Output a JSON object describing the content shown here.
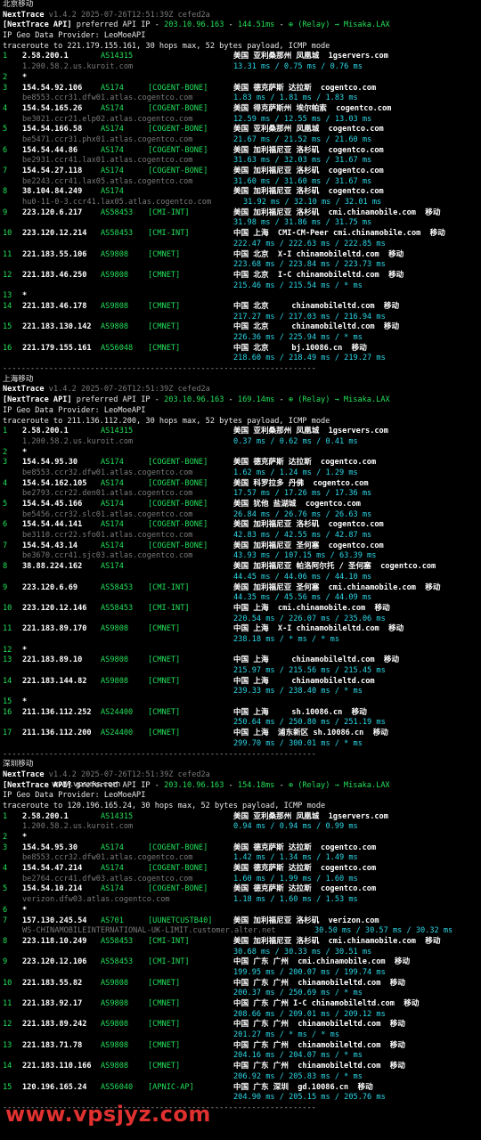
{
  "theme": {
    "background": "#000000",
    "hop_green": "#22e05a",
    "latency_cyan": "#2ad8e8",
    "dim": "#7a7a7a",
    "watermark_red": "#e03030"
  },
  "sections": [
    {
      "title": "北京移动",
      "banner": {
        "name": "NextTrace",
        "version": "v1.4.2 2025-07-26T12:51:39Z cefed2a"
      },
      "api_line": {
        "prefix": "[NextTrace API]",
        "label": "preferred API IP - ",
        "ip": "203.10.96.163",
        "sep1": " - ",
        "latency": "144.51ms",
        "sep2": " - ",
        "relay": "⊕ (Relay) → Misaka.LAX"
      },
      "geo_provider": "IP Geo Data Provider: LeoMoeAPI",
      "traceroute": "traceroute to 221.179.155.161, 30 hops max, 52 bytes payload, ICMP mode",
      "hops": [
        {
          "hop": "1",
          "ip": "2.58.200.1",
          "asn": "AS14315",
          "tag": "",
          "geo": "美国 亚利桑那州 凤凰城  1gservers.com",
          "sub": "1.200.58.2.us.kuroit.com",
          "rtt": "13.31 ms / 0.75 ms / 0.76 ms"
        },
        {
          "hop": "2",
          "ip": "*"
        },
        {
          "hop": "3",
          "ip": "154.54.92.106",
          "asn": "AS174",
          "tag": "[COGENT-BONE]",
          "geo": "美国 德克萨斯 达拉斯  cogentco.com",
          "sub": "be8553.ccr31.dfw01.atlas.cogentco.com",
          "rtt": "1.83 ms / 1.81 ms / 1.83 ms"
        },
        {
          "hop": "4",
          "ip": "154.54.165.26",
          "asn": "AS174",
          "tag": "[COGENT-BONE]",
          "geo": "美国 得克萨斯州 埃尔帕索  cogentco.com",
          "sub": "be3021.ccr21.elp02.atlas.cogentco.com",
          "rtt": "12.59 ms / 12.55 ms / 13.03 ms"
        },
        {
          "hop": "5",
          "ip": "154.54.166.58",
          "asn": "AS174",
          "tag": "[COGENT-BONE]",
          "geo": "美国 亚利桑那州 凤凰城  cogentco.com",
          "sub": "be5471.ccr31.phx01.atlas.cogentco.com",
          "rtt": "21.67 ms / 21.52 ms / 21.60 ms"
        },
        {
          "hop": "6",
          "ip": "154.54.44.86",
          "asn": "AS174",
          "tag": "[COGENT-BONE]",
          "geo": "美国 加利福尼亚 洛杉矶  cogentco.com",
          "sub": "be2931.ccr41.lax01.atlas.cogentco.com",
          "rtt": "31.63 ms / 32.03 ms / 31.67 ms"
        },
        {
          "hop": "7",
          "ip": "154.54.27.118",
          "asn": "AS174",
          "tag": "[COGENT-BONE]",
          "geo": "美国 加利福尼亚 洛杉矶  cogentco.com",
          "sub": "be2243.ccr41.lax05.atlas.cogentco.com",
          "rtt": "31.60 ms / 31.60 ms / 31.67 ms"
        },
        {
          "hop": "8",
          "ip": "38.104.84.249",
          "asn": "AS174",
          "tag": "",
          "geo": "美国 加利福尼亚 洛杉矶  cogentco.com",
          "sub": "hu0-11-0-3.ccr41.lax05.atlas.cogentco.com",
          "rtt": "31.92 ms / 32.10 ms / 32.01 ms",
          "rtt_offset": true
        },
        {
          "hop": "9",
          "ip": "223.120.6.217",
          "asn": "AS58453",
          "tag": "[CMI-INT]",
          "geo": "美国 加利福尼亚 洛杉矶  cmi.chinamobile.com  移动",
          "sub": "",
          "rtt": "31.98 ms / 31.86 ms / 31.75 ms"
        },
        {
          "hop": "10",
          "ip": "223.120.12.214",
          "asn": "AS58453",
          "tag": "[CMI-INT]",
          "geo": "中国 上海  CMI-CM-Peer cmi.chinamobile.com  移动",
          "sub": "",
          "rtt": "222.47 ms / 222.63 ms / 222.85 ms"
        },
        {
          "hop": "11",
          "ip": "221.183.55.106",
          "asn": "AS9808",
          "tag": "[CMNET]",
          "geo": "中国 北京  X-I chinamobileltd.com  移动",
          "sub": "",
          "rtt": "223.68 ms / 223.84 ms / 223.73 ms"
        },
        {
          "hop": "12",
          "ip": "221.183.46.250",
          "asn": "AS9808",
          "tag": "[CMNET]",
          "geo": "中国 北京  I-C chinamobileltd.com  移动",
          "sub": "",
          "rtt": "215.46 ms / 215.54 ms / * ms"
        },
        {
          "hop": "13",
          "ip": "*"
        },
        {
          "hop": "14",
          "ip": "221.183.46.178",
          "asn": "AS9808",
          "tag": "[CMNET]",
          "geo": "中国 北京     chinamobileltd.com  移动",
          "sub": "",
          "rtt": "217.27 ms / 217.03 ms / 216.94 ms"
        },
        {
          "hop": "15",
          "ip": "221.183.130.142",
          "asn": "AS9808",
          "tag": "[CMNET]",
          "geo": "中国 北京     chinamobileltd.com  移动",
          "sub": "",
          "rtt": "226.36 ms / 225.94 ms / * ms"
        },
        {
          "hop": "16",
          "ip": "221.179.155.161",
          "asn": "AS56048",
          "tag": "[CMNET]",
          "geo": "中国 北京     bj.10086.cn  移动",
          "sub": "",
          "rtt": "218.60 ms / 218.49 ms / 219.27 ms"
        }
      ]
    },
    {
      "title": "上海移动",
      "banner": {
        "name": "NextTrace",
        "version": "v1.4.2 2025-07-26T12:51:39Z cefed2a"
      },
      "api_line": {
        "prefix": "[NextTrace API]",
        "label": "preferred API IP - ",
        "ip": "203.10.96.163",
        "sep1": " - ",
        "latency": "169.14ms",
        "sep2": " - ",
        "relay": "⊕ (Relay) → Misaka.LAX"
      },
      "geo_provider": "IP Geo Data Provider: LeoMoeAPI",
      "traceroute": "traceroute to 211.136.112.200, 30 hops max, 52 bytes payload, ICMP mode",
      "hops": [
        {
          "hop": "1",
          "ip": "2.58.200.1",
          "asn": "AS14315",
          "tag": "",
          "geo": "美国 亚利桑那州 凤凰城  1gservers.com",
          "sub": "1.200.58.2.us.kuroit.com",
          "rtt": "0.37 ms / 0.62 ms / 0.41 ms"
        },
        {
          "hop": "2",
          "ip": "*"
        },
        {
          "hop": "3",
          "ip": "154.54.95.30",
          "asn": "AS174",
          "tag": "[COGENT-BONE]",
          "geo": "美国 德克萨斯 达拉斯  cogentco.com",
          "sub": "be8553.ccr32.dfw01.atlas.cogentco.com",
          "rtt": "1.62 ms / 1.24 ms / 1.29 ms"
        },
        {
          "hop": "4",
          "ip": "154.54.162.105",
          "asn": "AS174",
          "tag": "[COGENT-BONE]",
          "geo": "美国 科罗拉多 丹佛  cogentco.com",
          "sub": "be2793.ccr22.den01.atlas.cogentco.com",
          "rtt": "17.57 ms / 17.26 ms / 17.36 ms"
        },
        {
          "hop": "5",
          "ip": "154.54.45.166",
          "asn": "AS174",
          "tag": "[COGENT-BONE]",
          "geo": "美国 犹他 盐湖城  cogentco.com",
          "sub": "be5456.ccr32.slc01.atlas.cogentco.com",
          "rtt": "26.84 ms / 26.76 ms / 26.63 ms"
        },
        {
          "hop": "6",
          "ip": "154.54.44.141",
          "asn": "AS174",
          "tag": "[COGENT-BONE]",
          "geo": "美国 加利福尼亚 洛杉矶  cogentco.com",
          "sub": "be3110.ccr22.sfo01.atlas.cogentco.com",
          "rtt": "42.83 ms / 42.55 ms / 42.87 ms"
        },
        {
          "hop": "7",
          "ip": "154.54.43.14",
          "asn": "AS174",
          "tag": "[COGENT-BONE]",
          "geo": "美国 加利福尼亚 圣何塞  cogentco.com",
          "sub": "be3670.ccr41.sjc03.atlas.cogentco.com",
          "rtt": "43.93 ms / 107.15 ms / 63.39 ms"
        },
        {
          "hop": "8",
          "ip": "38.88.224.162",
          "asn": "AS174",
          "tag": "",
          "geo": "美国 加利福尼亚 帕洛阿尔托 / 圣何塞  cogentco.com",
          "sub": "",
          "rtt": "44.45 ms / 44.06 ms / 44.10 ms"
        },
        {
          "hop": "9",
          "ip": "223.120.6.69",
          "asn": "AS58453",
          "tag": "[CMI-INT]",
          "geo": "美国 加利福尼亚 圣何塞  cmi.chinamobile.com  移动",
          "sub": "",
          "rtt": "44.35 ms / 45.56 ms / 44.09 ms"
        },
        {
          "hop": "10",
          "ip": "223.120.12.146",
          "asn": "AS58453",
          "tag": "[CMI-INT]",
          "geo": "中国 上海  cmi.chinamobile.com  移动",
          "sub": "",
          "rtt": "220.54 ms / 226.07 ms / 235.06 ms"
        },
        {
          "hop": "11",
          "ip": "221.183.89.170",
          "asn": "AS9808",
          "tag": "[CMNET]",
          "geo": "中国 上海  X-I chinamobileltd.com  移动",
          "sub": "",
          "rtt": "238.18 ms / * ms / * ms"
        },
        {
          "hop": "12",
          "ip": "*"
        },
        {
          "hop": "13",
          "ip": "221.183.89.10",
          "asn": "AS9808",
          "tag": "[CMNET]",
          "geo": "中国 上海     chinamobileltd.com  移动",
          "sub": "",
          "rtt": "215.97 ms / 215.56 ms / 215.45 ms"
        },
        {
          "hop": "14",
          "ip": "221.183.144.82",
          "asn": "AS9808",
          "tag": "[CMNET]",
          "geo": "中国 上海     chinamobileltd.com",
          "sub": "",
          "rtt": "239.33 ms / 238.40 ms / * ms"
        },
        {
          "hop": "15",
          "ip": "*"
        },
        {
          "hop": "16",
          "ip": "211.136.112.252",
          "asn": "AS24400",
          "tag": "[CMNET]",
          "geo": "中国 上海     sh.10086.cn  移动",
          "sub": "",
          "rtt": "250.64 ms / 250.80 ms / 251.19 ms"
        },
        {
          "hop": "17",
          "ip": "211.136.112.200",
          "asn": "AS24400",
          "tag": "[CMNET]",
          "geo": "中国 上海  浦东新区 sh.10086.cn  移动",
          "sub": "",
          "rtt": "299.70 ms / 300.01 ms / * ms"
        }
      ]
    },
    {
      "title": "深圳移动",
      "banner": {
        "name": "NextTrace",
        "version": "v1.4.2 2025-07-26T12:51:39Z cefed2a"
      },
      "api_line": {
        "prefix": "[NextTrace API]",
        "label": "preferred API IP - ",
        "ip": "203.10.96.163",
        "sep1": " - ",
        "latency": "154.18ms",
        "sep2": " - ",
        "relay": "⊕ (Relay) → Misaka.LAX"
      },
      "geo_provider": "IP Geo Data Provider: LeoMoeAPI",
      "traceroute": "traceroute to 120.196.165.24, 30 hops max, 52 bytes payload, ICMP mode",
      "hops": [
        {
          "hop": "1",
          "ip": "2.58.200.1",
          "asn": "AS14315",
          "tag": "",
          "geo": "美国 亚利桑那州 凤凰城  1gservers.com",
          "sub": "1.200.58.2.us.kuroit.com",
          "rtt": "0.94 ms / 0.94 ms / 0.99 ms"
        },
        {
          "hop": "2",
          "ip": "*"
        },
        {
          "hop": "3",
          "ip": "154.54.95.30",
          "asn": "AS174",
          "tag": "[COGENT-BONE]",
          "geo": "美国 德克萨斯 达拉斯  cogentco.com",
          "sub": "be8553.ccr32.dfw01.atlas.cogentco.com",
          "rtt": "1.42 ms / 1.34 ms / 1.49 ms"
        },
        {
          "hop": "4",
          "ip": "154.54.47.214",
          "asn": "AS174",
          "tag": "[COGENT-BONE]",
          "geo": "美国 德克萨斯 达拉斯  cogentco.com",
          "sub": "be2764.ccr41.dfw03.atlas.cogentco.com",
          "rtt": "1.60 ms / 1.99 ms / 1.60 ms"
        },
        {
          "hop": "5",
          "ip": "154.54.10.214",
          "asn": "AS174",
          "tag": "[COGENT-BONE]",
          "geo": "美国 德克萨斯 达拉斯  cogentco.com",
          "sub": "verizon.dfw03.atlas.cogentco.com",
          "rtt": "1.18 ms / 1.60 ms / 1.53 ms"
        },
        {
          "hop": "6",
          "ip": "*"
        },
        {
          "hop": "7",
          "ip": "157.130.245.54",
          "asn": "AS701",
          "tag": "[UUNETCUSTB40]",
          "geo": "美国 加利福尼亚 洛杉矶  verizon.com",
          "sub": "WS-CHINAMOBILEINTERNATIONAL-UK-LIMIT.customer.alter.net",
          "rtt": "30.50 ms / 30.57 ms / 30.32 ms",
          "rtt_inline": true
        },
        {
          "hop": "8",
          "ip": "223.118.10.249",
          "asn": "AS58453",
          "tag": "[CMI-INT]",
          "geo": "美国 加利福尼亚 洛杉矶  cmi.chinamobile.com  移动",
          "sub": "",
          "rtt": "30.68 ms / 30.33 ms / 30.51 ms"
        },
        {
          "hop": "9",
          "ip": "223.120.12.106",
          "asn": "AS58453",
          "tag": "[CMI-INT]",
          "geo": "中国 广东 广州  cmi.chinamobile.com  移动",
          "sub": "",
          "rtt": "199.95 ms / 200.07 ms / 199.74 ms"
        },
        {
          "hop": "10",
          "ip": "221.183.55.82",
          "asn": "AS9808",
          "tag": "[CMNET]",
          "geo": "中国 广东 广州  chinamobileltd.com  移动",
          "sub": "",
          "rtt": "200.37 ms / 250.69 ms / * ms"
        },
        {
          "hop": "11",
          "ip": "221.183.92.17",
          "asn": "AS9808",
          "tag": "[CMNET]",
          "geo": "中国 广东 广州 I-C chinamobileltd.com  移动",
          "sub": "",
          "rtt": "208.66 ms / 209.01 ms / 209.12 ms"
        },
        {
          "hop": "12",
          "ip": "221.183.89.242",
          "asn": "AS9808",
          "tag": "[CMNET]",
          "geo": "中国 广东 广州  chinamobileltd.com  移动",
          "sub": "",
          "rtt": "201.27 ms / * ms / * ms"
        },
        {
          "hop": "13",
          "ip": "221.183.71.78",
          "asn": "AS9808",
          "tag": "[CMNET]",
          "geo": "中国 广东 广州  chinamobileltd.com  移动",
          "sub": "",
          "rtt": "204.16 ms / 204.07 ms / * ms"
        },
        {
          "hop": "14",
          "ip": "221.183.110.166",
          "asn": "AS9808",
          "tag": "[CMNET]",
          "geo": "中国 广东 广州  chinamobileltd.com  移动",
          "sub": "",
          "rtt": "206.92 ms / 205.83 ms / * ms"
        },
        {
          "hop": "15",
          "ip": "120.196.165.24",
          "asn": "AS56040",
          "tag": "[APNIC-AP]",
          "geo": "中国 广东 深圳  gd.10086.cn  移动",
          "sub": "",
          "rtt": "204.90 ms / 205.15 ms / 205.76 ms"
        }
      ]
    }
  ],
  "divider": "--------------------------------------------------------------------",
  "watermarks": {
    "top": "www.vpsxxs.com",
    "bottom": "www.vpsjyz.com"
  }
}
